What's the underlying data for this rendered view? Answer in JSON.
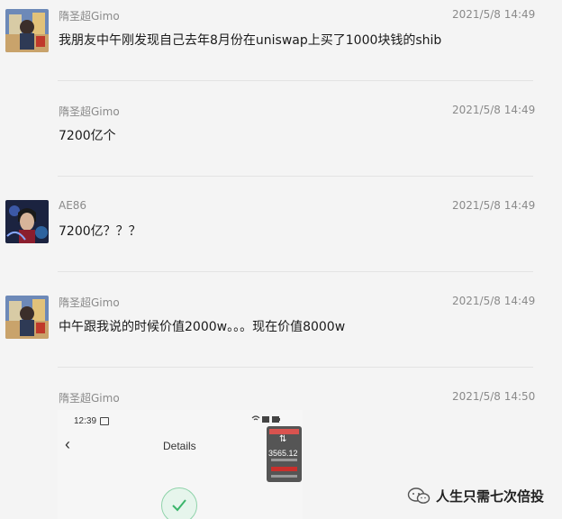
{
  "messages": [
    {
      "sender": "隋圣超Gimo",
      "time": "2021/5/8 14:49",
      "text": "我朋友中午刚发现自己去年8月份在uniswap上买了1000块钱的shib",
      "avatar": "avatar-gimo"
    },
    {
      "sender": "隋圣超Gimo",
      "time": "2021/5/8 14:49",
      "text": "7200亿个",
      "avatar": ""
    },
    {
      "sender": "AE86",
      "time": "2021/5/8 14:49",
      "text": "7200亿？？？",
      "avatar": "avatar-ae86"
    },
    {
      "sender": "隋圣超Gimo",
      "time": "2021/5/8 14:49",
      "text": "中午跟我说的时候价值2000w。。。现在价值8000w",
      "avatar": "avatar-gimo"
    },
    {
      "sender": "隋圣超Gimo",
      "time": "2021/5/8 14:50",
      "text": "",
      "avatar": ""
    }
  ],
  "screenshot": {
    "status_time": "12:39",
    "screen_title": "Details",
    "back_icon": "chevron-left-icon",
    "check_icon": "check-circle-icon"
  },
  "thumbnail": {
    "value": "3565.12"
  },
  "watermark": {
    "icon": "wechat-icon",
    "text": "人生只需七次倍投"
  }
}
